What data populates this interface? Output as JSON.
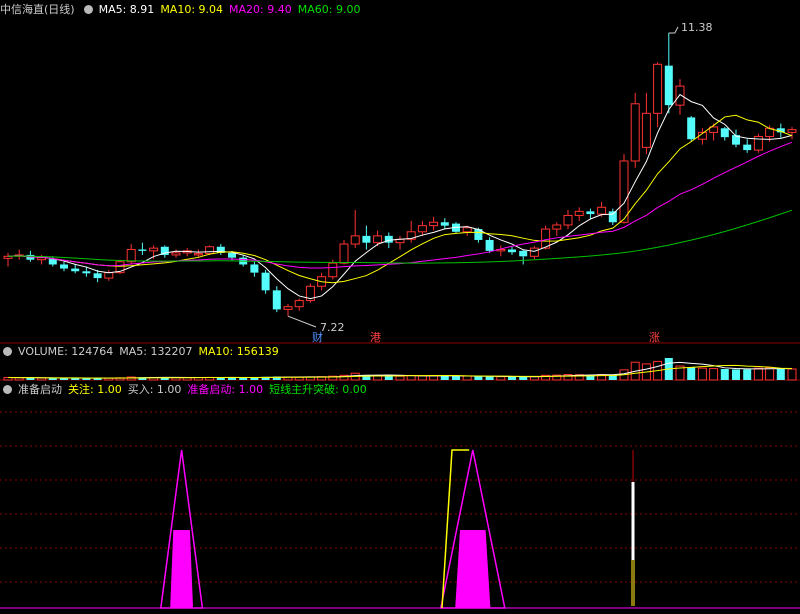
{
  "price_header": {
    "title": "中信海直(日线)",
    "ma5": "MA5: 8.91",
    "ma10": "MA10: 9.04",
    "ma20": "MA20: 9.40",
    "ma60": "MA60: 9.00"
  },
  "volume_header": {
    "title": "VOLUME: 124764",
    "ma5": "MA5: 132207",
    "ma10": "MA10: 156139"
  },
  "indicator_header": {
    "title": "准备启动",
    "guanzhu": "关注: 1.00",
    "mairu": "买入: 1.00",
    "zhunbei": "准备启动: 1.00",
    "tupo": "短线主升突破: 0.00"
  },
  "annotations": {
    "high": "11.38",
    "low": "7.22",
    "marker1": "财",
    "marker2": "港",
    "marker3": "涨"
  },
  "colors": {
    "ma5": "#ffffff",
    "ma10": "#ffff00",
    "ma20": "#ff00ff",
    "ma60": "#00c000",
    "up": "#ff3232",
    "down": "#54fcfc",
    "grid": "#8b0000"
  },
  "chart_data": [
    {
      "type": "candlestick",
      "title": "中信海直(日线)",
      "ohlc_note": "open, high, low, close per trading day",
      "series": [
        {
          "o": 8.07,
          "h": 8.15,
          "l": 7.95,
          "c": 8.1
        },
        {
          "o": 8.1,
          "h": 8.2,
          "l": 8.05,
          "c": 8.12
        },
        {
          "o": 8.12,
          "h": 8.18,
          "l": 8.02,
          "c": 8.05
        },
        {
          "o": 8.05,
          "h": 8.12,
          "l": 7.98,
          "c": 8.08
        },
        {
          "o": 8.06,
          "h": 8.1,
          "l": 7.95,
          "c": 7.98
        },
        {
          "o": 7.98,
          "h": 8.02,
          "l": 7.88,
          "c": 7.92
        },
        {
          "o": 7.92,
          "h": 7.98,
          "l": 7.85,
          "c": 7.88
        },
        {
          "o": 7.88,
          "h": 7.95,
          "l": 7.8,
          "c": 7.85
        },
        {
          "o": 7.85,
          "h": 7.9,
          "l": 7.72,
          "c": 7.78
        },
        {
          "o": 7.78,
          "h": 7.9,
          "l": 7.74,
          "c": 7.86
        },
        {
          "o": 7.86,
          "h": 8.05,
          "l": 7.84,
          "c": 8.02
        },
        {
          "o": 8.02,
          "h": 8.28,
          "l": 7.98,
          "c": 8.2
        },
        {
          "o": 8.2,
          "h": 8.3,
          "l": 8.12,
          "c": 8.18
        },
        {
          "o": 8.18,
          "h": 8.26,
          "l": 8.06,
          "c": 8.22
        },
        {
          "o": 8.24,
          "h": 8.26,
          "l": 8.08,
          "c": 8.12
        },
        {
          "o": 8.12,
          "h": 8.2,
          "l": 8.08,
          "c": 8.15
        },
        {
          "o": 8.15,
          "h": 8.22,
          "l": 8.1,
          "c": 8.18
        },
        {
          "o": 8.12,
          "h": 8.2,
          "l": 8.08,
          "c": 8.14
        },
        {
          "o": 8.14,
          "h": 8.26,
          "l": 8.12,
          "c": 8.24
        },
        {
          "o": 8.24,
          "h": 8.28,
          "l": 8.12,
          "c": 8.15
        },
        {
          "o": 8.15,
          "h": 8.18,
          "l": 8.04,
          "c": 8.08
        },
        {
          "o": 8.08,
          "h": 8.12,
          "l": 7.95,
          "c": 7.98
        },
        {
          "o": 7.98,
          "h": 8.02,
          "l": 7.8,
          "c": 7.86
        },
        {
          "o": 7.86,
          "h": 7.9,
          "l": 7.55,
          "c": 7.6
        },
        {
          "o": 7.6,
          "h": 7.66,
          "l": 7.28,
          "c": 7.32
        },
        {
          "o": 7.32,
          "h": 7.4,
          "l": 7.22,
          "c": 7.36
        },
        {
          "o": 7.36,
          "h": 7.48,
          "l": 7.3,
          "c": 7.45
        },
        {
          "o": 7.45,
          "h": 7.7,
          "l": 7.42,
          "c": 7.66
        },
        {
          "o": 7.66,
          "h": 7.86,
          "l": 7.6,
          "c": 7.8
        },
        {
          "o": 7.8,
          "h": 8.05,
          "l": 7.76,
          "c": 8.0
        },
        {
          "o": 8.0,
          "h": 8.34,
          "l": 7.98,
          "c": 8.28
        },
        {
          "o": 8.28,
          "h": 8.78,
          "l": 8.22,
          "c": 8.4
        },
        {
          "o": 8.4,
          "h": 8.55,
          "l": 8.2,
          "c": 8.3
        },
        {
          "o": 8.3,
          "h": 8.48,
          "l": 8.25,
          "c": 8.4
        },
        {
          "o": 8.4,
          "h": 8.45,
          "l": 8.22,
          "c": 8.3
        },
        {
          "o": 8.3,
          "h": 8.4,
          "l": 8.2,
          "c": 8.35
        },
        {
          "o": 8.35,
          "h": 8.62,
          "l": 8.3,
          "c": 8.46
        },
        {
          "o": 8.46,
          "h": 8.62,
          "l": 8.4,
          "c": 8.55
        },
        {
          "o": 8.55,
          "h": 8.68,
          "l": 8.48,
          "c": 8.6
        },
        {
          "o": 8.6,
          "h": 8.66,
          "l": 8.5,
          "c": 8.55
        },
        {
          "o": 8.58,
          "h": 8.6,
          "l": 8.44,
          "c": 8.46
        },
        {
          "o": 8.46,
          "h": 8.55,
          "l": 8.4,
          "c": 8.52
        },
        {
          "o": 8.5,
          "h": 8.52,
          "l": 8.3,
          "c": 8.34
        },
        {
          "o": 8.34,
          "h": 8.38,
          "l": 8.15,
          "c": 8.18
        },
        {
          "o": 8.18,
          "h": 8.26,
          "l": 8.1,
          "c": 8.2
        },
        {
          "o": 8.2,
          "h": 8.24,
          "l": 8.12,
          "c": 8.16
        },
        {
          "o": 8.18,
          "h": 8.2,
          "l": 7.98,
          "c": 8.1
        },
        {
          "o": 8.1,
          "h": 8.25,
          "l": 8.06,
          "c": 8.22
        },
        {
          "o": 8.22,
          "h": 8.55,
          "l": 8.2,
          "c": 8.5
        },
        {
          "o": 8.5,
          "h": 8.6,
          "l": 8.4,
          "c": 8.56
        },
        {
          "o": 8.56,
          "h": 8.78,
          "l": 8.5,
          "c": 8.7
        },
        {
          "o": 8.7,
          "h": 8.82,
          "l": 8.62,
          "c": 8.76
        },
        {
          "o": 8.76,
          "h": 8.8,
          "l": 8.64,
          "c": 8.72
        },
        {
          "o": 8.72,
          "h": 8.9,
          "l": 8.68,
          "c": 8.82
        },
        {
          "o": 8.76,
          "h": 8.8,
          "l": 8.56,
          "c": 8.6
        },
        {
          "o": 8.6,
          "h": 9.6,
          "l": 8.58,
          "c": 9.5
        },
        {
          "o": 9.5,
          "h": 10.5,
          "l": 9.4,
          "c": 10.34
        },
        {
          "o": 9.7,
          "h": 10.5,
          "l": 9.6,
          "c": 10.2
        },
        {
          "o": 10.2,
          "h": 10.95,
          "l": 10.0,
          "c": 10.92
        },
        {
          "o": 10.9,
          "h": 11.38,
          "l": 10.2,
          "c": 10.32
        },
        {
          "o": 10.32,
          "h": 10.7,
          "l": 10.18,
          "c": 10.6
        },
        {
          "o": 10.14,
          "h": 10.16,
          "l": 9.78,
          "c": 9.82
        },
        {
          "o": 9.82,
          "h": 9.98,
          "l": 9.74,
          "c": 9.92
        },
        {
          "o": 9.92,
          "h": 10.05,
          "l": 9.8,
          "c": 10.0
        },
        {
          "o": 9.98,
          "h": 10.0,
          "l": 9.8,
          "c": 9.85
        },
        {
          "o": 9.88,
          "h": 9.96,
          "l": 9.7,
          "c": 9.74
        },
        {
          "o": 9.74,
          "h": 9.82,
          "l": 9.62,
          "c": 9.66
        },
        {
          "o": 9.66,
          "h": 9.9,
          "l": 9.62,
          "c": 9.86
        },
        {
          "o": 9.86,
          "h": 10.02,
          "l": 9.78,
          "c": 9.98
        },
        {
          "o": 9.98,
          "h": 10.05,
          "l": 9.84,
          "c": 9.92
        },
        {
          "o": 9.92,
          "h": 10.0,
          "l": 9.82,
          "c": 9.96
        }
      ]
    },
    {
      "type": "bar",
      "title": "VOLUME: 124764",
      "values": [
        60,
        55,
        50,
        48,
        45,
        45,
        44,
        42,
        40,
        44,
        52,
        70,
        65,
        60,
        58,
        55,
        60,
        58,
        62,
        60,
        58,
        55,
        62,
        75,
        80,
        70,
        65,
        72,
        78,
        90,
        110,
        160,
        120,
        100,
        95,
        90,
        105,
        100,
        98,
        92,
        90,
        95,
        85,
        80,
        78,
        76,
        74,
        80,
        110,
        115,
        130,
        125,
        118,
        130,
        120,
        240,
        420,
        380,
        440,
        520,
        330,
        300,
        280,
        270,
        260,
        250,
        250,
        280,
        290,
        270,
        260
      ]
    },
    {
      "type": "area",
      "title": "准备启动",
      "series": [
        {
          "name": "准备启动",
          "spikes": [
            {
              "start": 14,
              "end": 17
            },
            {
              "start": 39,
              "end": 44
            }
          ]
        },
        {
          "name": "关注",
          "spikes": [
            {
              "start": 40,
              "end": 41
            }
          ]
        },
        {
          "name": "买入",
          "spikes": [
            {
              "start": 64,
              "end": 64
            }
          ]
        }
      ]
    }
  ]
}
